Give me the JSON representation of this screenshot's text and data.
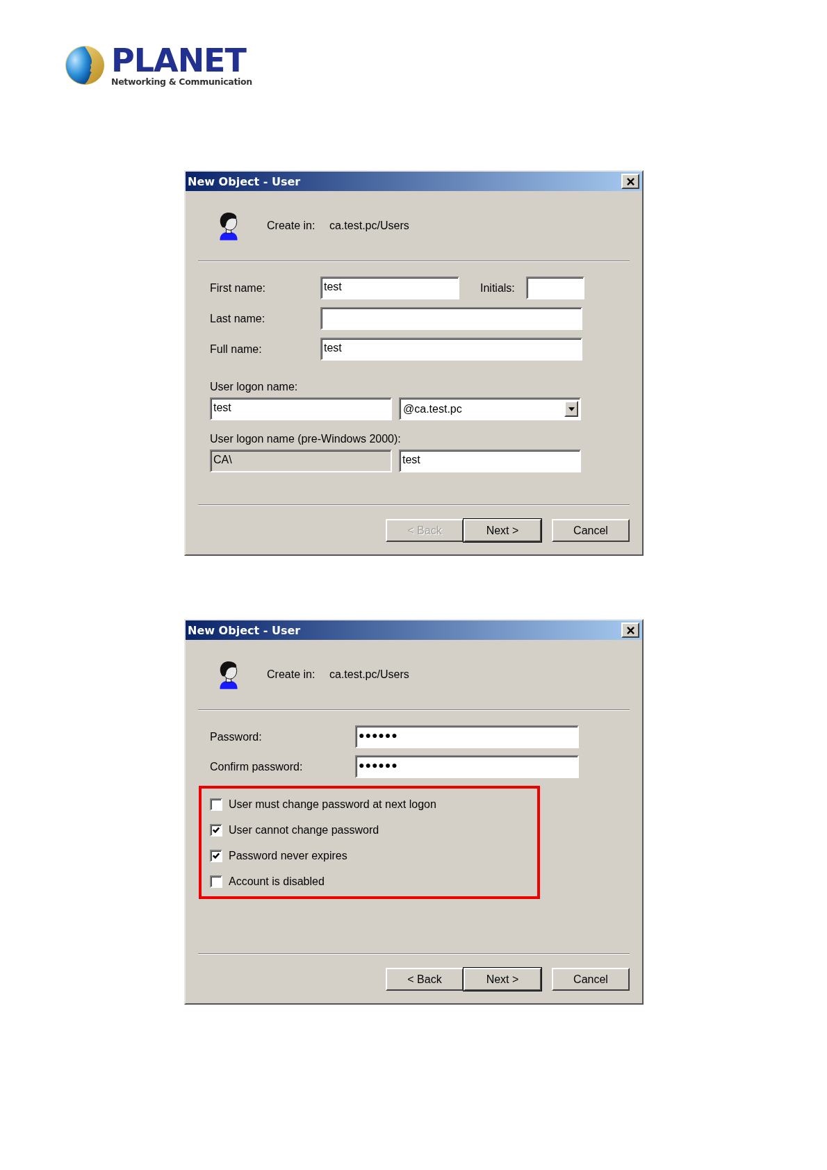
{
  "logo": {
    "name": "PLANET",
    "tagline": "Networking & Communication"
  },
  "dialogs": [
    {
      "title": "New Object - User",
      "create_in_label": "Create in:",
      "create_in_value": "ca.test.pc/Users",
      "rows": [
        {
          "kind": "field",
          "label": "First name:",
          "value": "test",
          "side": {
            "label": "Initials:"
          }
        },
        {
          "kind": "field",
          "label": "Last name:"
        },
        {
          "kind": "field",
          "label": "Full name:",
          "value": "test"
        },
        {
          "kind": "heading",
          "label": "User logon name:"
        },
        {
          "kind": "pair",
          "left": {
            "value": "test",
            "disabled": false
          },
          "right": {
            "value": "@ca.test.pc",
            "dropdown": true
          }
        },
        {
          "kind": "heading",
          "label": "User logon name (pre-Windows 2000):"
        },
        {
          "kind": "pair",
          "left": {
            "value": "CA\\",
            "disabled": true
          },
          "right": {
            "value": "test",
            "dropdown": false
          }
        }
      ],
      "buttons": [
        {
          "label": "< Back",
          "disabled": true,
          "default": false
        },
        {
          "label": "Next >",
          "disabled": false,
          "default": true
        },
        {
          "label": "Cancel",
          "disabled": false,
          "default": false
        }
      ]
    },
    {
      "title": "New Object - User",
      "create_in_label": "Create in:",
      "create_in_value": "ca.test.pc/Users",
      "rows": [
        {
          "kind": "password",
          "label": "Password:",
          "value": "●●●●●●"
        },
        {
          "kind": "password",
          "label": "Confirm password:",
          "value": "●●●●●●"
        },
        {
          "kind": "checks",
          "highlighted": true,
          "items": [
            {
              "label": "User must change password at next logon",
              "checked": false
            },
            {
              "label": "User cannot change password",
              "checked": true
            },
            {
              "label": "Password never expires",
              "checked": true
            },
            {
              "label": "Account is disabled",
              "checked": false
            }
          ]
        }
      ],
      "buttons": [
        {
          "label": "< Back",
          "disabled": false,
          "default": false
        },
        {
          "label": "Next >",
          "disabled": false,
          "default": true
        },
        {
          "label": "Cancel",
          "disabled": false,
          "default": false
        }
      ]
    }
  ]
}
